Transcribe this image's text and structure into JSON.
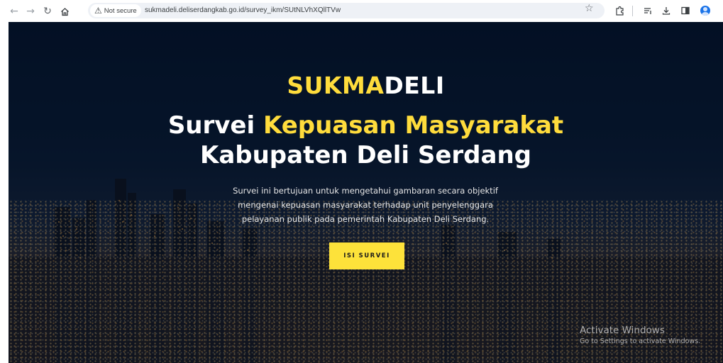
{
  "browser": {
    "security_label": "Not secure",
    "url": "sukmadeli.deliserdangkab.go.id/survey_ikm/SUtNLVhXQllTVw",
    "icons": {
      "back": "back-arrow-icon",
      "forward": "forward-arrow-icon",
      "reload": "reload-icon",
      "home": "home-icon",
      "security_warning": "warning-triangle-icon",
      "bookmark": "star-icon",
      "extensions": "puzzle-icon",
      "reading_list": "reading-list-icon",
      "downloads": "download-icon",
      "side_panel": "side-panel-icon",
      "profile": "profile-avatar-icon"
    }
  },
  "hero": {
    "brand_highlight": "SUKMA",
    "brand_rest": "DELI",
    "headline_line1_white": "Survei ",
    "headline_line1_yellow": "Kepuasan Masyarakat",
    "headline_line2": "Kabupaten Deli Serdang",
    "description_lines": [
      "Survei ini bertujuan untuk mengetahui gambaran secara objektif",
      "mengenai kepuasan masyarakat terhadap unit penyelenggara",
      "pelayanan publik pada pemerintah Kabupaten Deli Serdang."
    ],
    "cta_label": "ISI SURVEI"
  },
  "watermark": {
    "line1": "Activate Windows",
    "line2": "Go to Settings to activate Windows."
  },
  "colors": {
    "accent_yellow": "#ffdc3c",
    "button_yellow": "#fde23a",
    "omnibox_bg": "#eef1f6"
  }
}
